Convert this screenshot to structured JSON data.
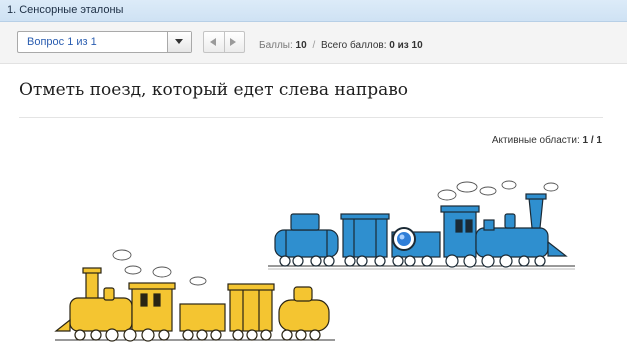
{
  "header": {
    "breadcrumb": "1. Сенсорные эталоны"
  },
  "toolbar": {
    "question_select": {
      "value": "Вопрос 1 из 1"
    },
    "score": {
      "points_label": "Баллы:",
      "points": "10",
      "separator": "/",
      "total_label": "Всего баллов:",
      "total": "0 из 10"
    }
  },
  "question": {
    "text": "Отметь поезд, который едет слева направо"
  },
  "hotspots": {
    "label": "Активные области:",
    "value": "1 / 1"
  },
  "icons": {
    "dropdown": "chevron-down-icon",
    "prev": "arrow-left-icon",
    "next": "arrow-right-icon",
    "marker": "selection-marker-icon"
  },
  "colors": {
    "blue_train": "#2f8fcf",
    "yellow_train": "#f4c531",
    "link_blue": "#2a5db0",
    "header_bg": "#d6e7f7"
  }
}
